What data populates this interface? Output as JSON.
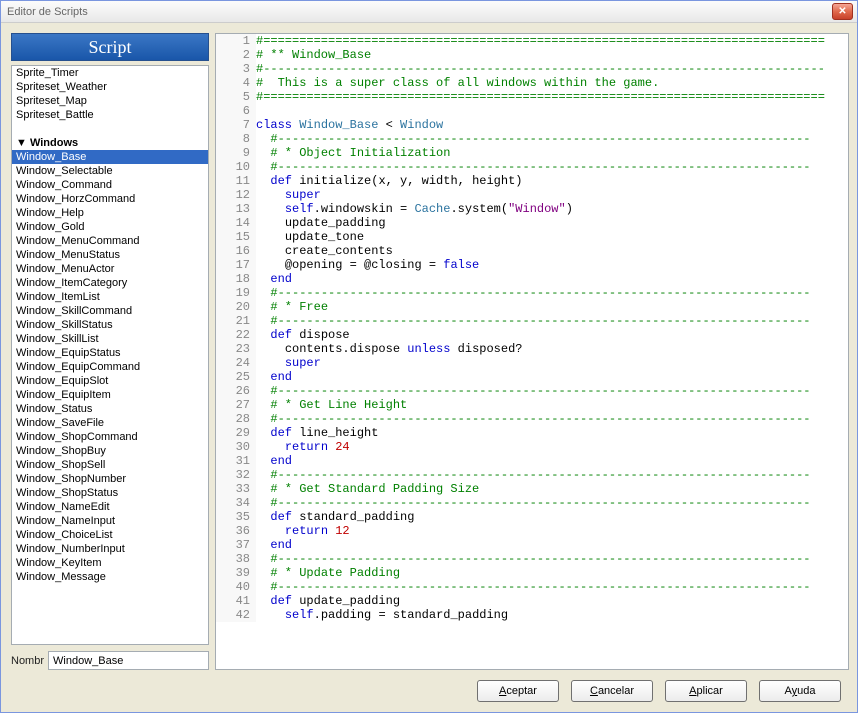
{
  "window": {
    "title": "Editor de Scripts"
  },
  "sidebar": {
    "header": "Script",
    "items": [
      {
        "label": "Sprite_Timer",
        "selected": false,
        "group": false
      },
      {
        "label": "Spriteset_Weather",
        "selected": false,
        "group": false
      },
      {
        "label": "Spriteset_Map",
        "selected": false,
        "group": false
      },
      {
        "label": "Spriteset_Battle",
        "selected": false,
        "group": false
      },
      {
        "label": "",
        "selected": false,
        "group": false
      },
      {
        "label": "▼ Windows",
        "selected": false,
        "group": true
      },
      {
        "label": "Window_Base",
        "selected": true,
        "group": false
      },
      {
        "label": "Window_Selectable",
        "selected": false,
        "group": false
      },
      {
        "label": "Window_Command",
        "selected": false,
        "group": false
      },
      {
        "label": "Window_HorzCommand",
        "selected": false,
        "group": false
      },
      {
        "label": "Window_Help",
        "selected": false,
        "group": false
      },
      {
        "label": "Window_Gold",
        "selected": false,
        "group": false
      },
      {
        "label": "Window_MenuCommand",
        "selected": false,
        "group": false
      },
      {
        "label": "Window_MenuStatus",
        "selected": false,
        "group": false
      },
      {
        "label": "Window_MenuActor",
        "selected": false,
        "group": false
      },
      {
        "label": "Window_ItemCategory",
        "selected": false,
        "group": false
      },
      {
        "label": "Window_ItemList",
        "selected": false,
        "group": false
      },
      {
        "label": "Window_SkillCommand",
        "selected": false,
        "group": false
      },
      {
        "label": "Window_SkillStatus",
        "selected": false,
        "group": false
      },
      {
        "label": "Window_SkillList",
        "selected": false,
        "group": false
      },
      {
        "label": "Window_EquipStatus",
        "selected": false,
        "group": false
      },
      {
        "label": "Window_EquipCommand",
        "selected": false,
        "group": false
      },
      {
        "label": "Window_EquipSlot",
        "selected": false,
        "group": false
      },
      {
        "label": "Window_EquipItem",
        "selected": false,
        "group": false
      },
      {
        "label": "Window_Status",
        "selected": false,
        "group": false
      },
      {
        "label": "Window_SaveFile",
        "selected": false,
        "group": false
      },
      {
        "label": "Window_ShopCommand",
        "selected": false,
        "group": false
      },
      {
        "label": "Window_ShopBuy",
        "selected": false,
        "group": false
      },
      {
        "label": "Window_ShopSell",
        "selected": false,
        "group": false
      },
      {
        "label": "Window_ShopNumber",
        "selected": false,
        "group": false
      },
      {
        "label": "Window_ShopStatus",
        "selected": false,
        "group": false
      },
      {
        "label": "Window_NameEdit",
        "selected": false,
        "group": false
      },
      {
        "label": "Window_NameInput",
        "selected": false,
        "group": false
      },
      {
        "label": "Window_ChoiceList",
        "selected": false,
        "group": false
      },
      {
        "label": "Window_NumberInput",
        "selected": false,
        "group": false
      },
      {
        "label": "Window_KeyItem",
        "selected": false,
        "group": false
      },
      {
        "label": "Window_Message",
        "selected": false,
        "group": false
      }
    ]
  },
  "name": {
    "label": "Nombr",
    "value": "Window_Base"
  },
  "buttons": {
    "accept": "Aceptar",
    "cancel": "Cancelar",
    "apply": "Aplicar",
    "help": "Ayuda"
  },
  "code": [
    {
      "n": 1,
      "t": [
        [
          "comment",
          "#=============================================================================="
        ]
      ]
    },
    {
      "n": 2,
      "t": [
        [
          "comment",
          "# ** Window_Base"
        ]
      ]
    },
    {
      "n": 3,
      "t": [
        [
          "comment",
          "#------------------------------------------------------------------------------"
        ]
      ]
    },
    {
      "n": 4,
      "t": [
        [
          "comment",
          "#  This is a super class of all windows within the game."
        ]
      ]
    },
    {
      "n": 5,
      "t": [
        [
          "comment",
          "#=============================================================================="
        ]
      ]
    },
    {
      "n": 6,
      "t": [
        [
          "",
          ""
        ]
      ]
    },
    {
      "n": 7,
      "t": [
        [
          "keyword",
          "class"
        ],
        [
          "",
          " "
        ],
        [
          "const",
          "Window_Base"
        ],
        [
          "",
          " < "
        ],
        [
          "const",
          "Window"
        ]
      ]
    },
    {
      "n": 8,
      "t": [
        [
          "",
          "  "
        ],
        [
          "comment",
          "#--------------------------------------------------------------------------"
        ]
      ]
    },
    {
      "n": 9,
      "t": [
        [
          "",
          "  "
        ],
        [
          "comment",
          "# * Object Initialization"
        ]
      ]
    },
    {
      "n": 10,
      "t": [
        [
          "",
          "  "
        ],
        [
          "comment",
          "#--------------------------------------------------------------------------"
        ]
      ]
    },
    {
      "n": 11,
      "t": [
        [
          "",
          "  "
        ],
        [
          "keyword",
          "def"
        ],
        [
          "",
          " "
        ],
        [
          "ident",
          "initialize"
        ],
        [
          "op",
          "("
        ],
        [
          "ident",
          "x"
        ],
        [
          "op",
          ", "
        ],
        [
          "ident",
          "y"
        ],
        [
          "op",
          ", "
        ],
        [
          "ident",
          "width"
        ],
        [
          "op",
          ", "
        ],
        [
          "ident",
          "height"
        ],
        [
          "op",
          ")"
        ]
      ]
    },
    {
      "n": 12,
      "t": [
        [
          "",
          "    "
        ],
        [
          "keyword",
          "super"
        ]
      ]
    },
    {
      "n": 13,
      "t": [
        [
          "",
          "    "
        ],
        [
          "keyword",
          "self"
        ],
        [
          "op",
          "."
        ],
        [
          "ident",
          "windowskin"
        ],
        [
          "op",
          " = "
        ],
        [
          "const",
          "Cache"
        ],
        [
          "op",
          "."
        ],
        [
          "ident",
          "system"
        ],
        [
          "op",
          "("
        ],
        [
          "string",
          "\"Window\""
        ],
        [
          "op",
          ")"
        ]
      ]
    },
    {
      "n": 14,
      "t": [
        [
          "",
          "    "
        ],
        [
          "ident",
          "update_padding"
        ]
      ]
    },
    {
      "n": 15,
      "t": [
        [
          "",
          "    "
        ],
        [
          "ident",
          "update_tone"
        ]
      ]
    },
    {
      "n": 16,
      "t": [
        [
          "",
          "    "
        ],
        [
          "ident",
          "create_contents"
        ]
      ]
    },
    {
      "n": 17,
      "t": [
        [
          "",
          "    "
        ],
        [
          "ident",
          "@opening"
        ],
        [
          "op",
          " = "
        ],
        [
          "ident",
          "@closing"
        ],
        [
          "op",
          " = "
        ],
        [
          "keyword",
          "false"
        ]
      ]
    },
    {
      "n": 18,
      "t": [
        [
          "",
          "  "
        ],
        [
          "keyword",
          "end"
        ]
      ]
    },
    {
      "n": 19,
      "t": [
        [
          "",
          "  "
        ],
        [
          "comment",
          "#--------------------------------------------------------------------------"
        ]
      ]
    },
    {
      "n": 20,
      "t": [
        [
          "",
          "  "
        ],
        [
          "comment",
          "# * Free"
        ]
      ]
    },
    {
      "n": 21,
      "t": [
        [
          "",
          "  "
        ],
        [
          "comment",
          "#--------------------------------------------------------------------------"
        ]
      ]
    },
    {
      "n": 22,
      "t": [
        [
          "",
          "  "
        ],
        [
          "keyword",
          "def"
        ],
        [
          "",
          " "
        ],
        [
          "ident",
          "dispose"
        ]
      ]
    },
    {
      "n": 23,
      "t": [
        [
          "",
          "    "
        ],
        [
          "ident",
          "contents"
        ],
        [
          "op",
          "."
        ],
        [
          "ident",
          "dispose"
        ],
        [
          "",
          " "
        ],
        [
          "keyword",
          "unless"
        ],
        [
          "",
          " "
        ],
        [
          "ident",
          "disposed?"
        ]
      ]
    },
    {
      "n": 24,
      "t": [
        [
          "",
          "    "
        ],
        [
          "keyword",
          "super"
        ]
      ]
    },
    {
      "n": 25,
      "t": [
        [
          "",
          "  "
        ],
        [
          "keyword",
          "end"
        ]
      ]
    },
    {
      "n": 26,
      "t": [
        [
          "",
          "  "
        ],
        [
          "comment",
          "#--------------------------------------------------------------------------"
        ]
      ]
    },
    {
      "n": 27,
      "t": [
        [
          "",
          "  "
        ],
        [
          "comment",
          "# * Get Line Height"
        ]
      ]
    },
    {
      "n": 28,
      "t": [
        [
          "",
          "  "
        ],
        [
          "comment",
          "#--------------------------------------------------------------------------"
        ]
      ]
    },
    {
      "n": 29,
      "t": [
        [
          "",
          "  "
        ],
        [
          "keyword",
          "def"
        ],
        [
          "",
          " "
        ],
        [
          "ident",
          "line_height"
        ]
      ]
    },
    {
      "n": 30,
      "t": [
        [
          "",
          "    "
        ],
        [
          "keyword",
          "return"
        ],
        [
          "",
          " "
        ],
        [
          "number",
          "24"
        ]
      ]
    },
    {
      "n": 31,
      "t": [
        [
          "",
          "  "
        ],
        [
          "keyword",
          "end"
        ]
      ]
    },
    {
      "n": 32,
      "t": [
        [
          "",
          "  "
        ],
        [
          "comment",
          "#--------------------------------------------------------------------------"
        ]
      ]
    },
    {
      "n": 33,
      "t": [
        [
          "",
          "  "
        ],
        [
          "comment",
          "# * Get Standard Padding Size"
        ]
      ]
    },
    {
      "n": 34,
      "t": [
        [
          "",
          "  "
        ],
        [
          "comment",
          "#--------------------------------------------------------------------------"
        ]
      ]
    },
    {
      "n": 35,
      "t": [
        [
          "",
          "  "
        ],
        [
          "keyword",
          "def"
        ],
        [
          "",
          " "
        ],
        [
          "ident",
          "standard_padding"
        ]
      ]
    },
    {
      "n": 36,
      "t": [
        [
          "",
          "    "
        ],
        [
          "keyword",
          "return"
        ],
        [
          "",
          " "
        ],
        [
          "number",
          "12"
        ]
      ]
    },
    {
      "n": 37,
      "t": [
        [
          "",
          "  "
        ],
        [
          "keyword",
          "end"
        ]
      ]
    },
    {
      "n": 38,
      "t": [
        [
          "",
          "  "
        ],
        [
          "comment",
          "#--------------------------------------------------------------------------"
        ]
      ]
    },
    {
      "n": 39,
      "t": [
        [
          "",
          "  "
        ],
        [
          "comment",
          "# * Update Padding"
        ]
      ]
    },
    {
      "n": 40,
      "t": [
        [
          "",
          "  "
        ],
        [
          "comment",
          "#--------------------------------------------------------------------------"
        ]
      ]
    },
    {
      "n": 41,
      "t": [
        [
          "",
          "  "
        ],
        [
          "keyword",
          "def"
        ],
        [
          "",
          " "
        ],
        [
          "ident",
          "update_padding"
        ]
      ]
    },
    {
      "n": 42,
      "t": [
        [
          "",
          "    "
        ],
        [
          "keyword",
          "self"
        ],
        [
          "op",
          "."
        ],
        [
          "ident",
          "padding"
        ],
        [
          "op",
          " = "
        ],
        [
          "ident",
          "standard_padding"
        ]
      ]
    }
  ]
}
